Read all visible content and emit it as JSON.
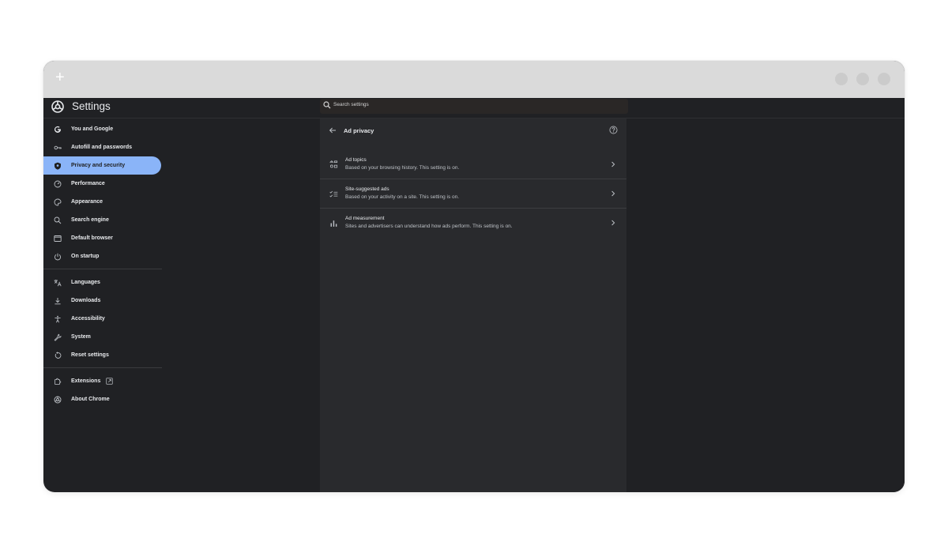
{
  "window": {
    "new_tab_symbol": "+"
  },
  "header": {
    "title": "Settings",
    "logo_icon": "chrome-logo-icon",
    "search_placeholder": "Search settings"
  },
  "sidebar": {
    "items": [
      {
        "label": "You and Google",
        "icon": "google-g-icon"
      },
      {
        "label": "Autofill and passwords",
        "icon": "key-icon"
      },
      {
        "label": "Privacy and security",
        "icon": "shield-icon",
        "active": true
      },
      {
        "label": "Performance",
        "icon": "speedometer-icon"
      },
      {
        "label": "Appearance",
        "icon": "palette-icon"
      },
      {
        "label": "Search engine",
        "icon": "search-icon"
      },
      {
        "label": "Default browser",
        "icon": "browser-window-icon"
      },
      {
        "label": "On startup",
        "icon": "power-icon"
      },
      {
        "label": "Languages",
        "icon": "translate-icon"
      },
      {
        "label": "Downloads",
        "icon": "download-icon"
      },
      {
        "label": "Accessibility",
        "icon": "accessibility-icon"
      },
      {
        "label": "System",
        "icon": "wrench-icon"
      },
      {
        "label": "Reset settings",
        "icon": "reset-icon"
      },
      {
        "label": "Extensions",
        "icon": "puzzle-icon"
      },
      {
        "label": "About Chrome",
        "icon": "chrome-logo-icon"
      }
    ]
  },
  "panel": {
    "title": "Ad privacy",
    "rows": [
      {
        "title": "Ad topics",
        "subtitle": "Based on your browsing history. This setting is on.",
        "icon": "topics-icon"
      },
      {
        "title": "Site-suggested ads",
        "subtitle": "Based on your activity on a site. This setting is on.",
        "icon": "checklist-icon"
      },
      {
        "title": "Ad measurement",
        "subtitle": "Sites and advertisers can understand how ads perform. This setting is on.",
        "icon": "bar-chart-icon"
      }
    ]
  },
  "colors": {
    "accent": "#8ab4f8",
    "background": "#202124",
    "panel": "#292a2d",
    "text": "#e8eaed",
    "titlebar": "#dadada"
  }
}
